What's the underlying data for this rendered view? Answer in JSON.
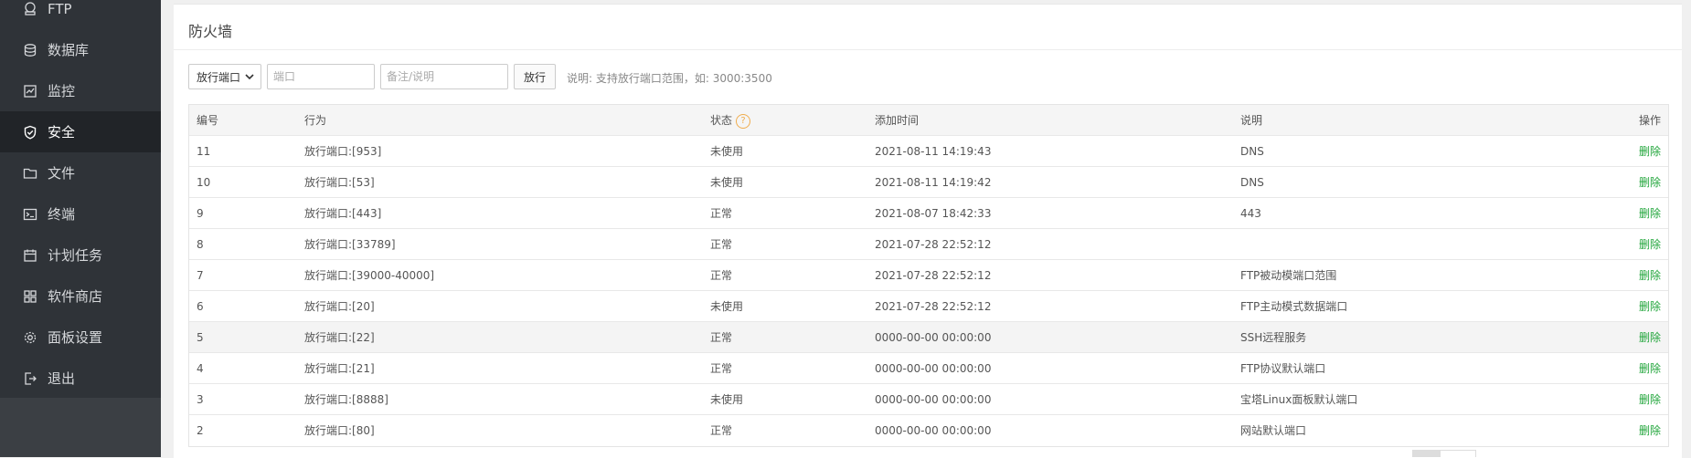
{
  "sidebar": {
    "items": [
      {
        "label": "FTP",
        "icon": "ftp-icon"
      },
      {
        "label": "数据库",
        "icon": "database-icon"
      },
      {
        "label": "监控",
        "icon": "monitor-icon"
      },
      {
        "label": "安全",
        "icon": "shield-icon",
        "active": true
      },
      {
        "label": "文件",
        "icon": "folder-icon"
      },
      {
        "label": "终端",
        "icon": "terminal-icon"
      },
      {
        "label": "计划任务",
        "icon": "calendar-icon"
      },
      {
        "label": "软件商店",
        "icon": "apps-icon"
      },
      {
        "label": "面板设置",
        "icon": "gear-icon"
      },
      {
        "label": "退出",
        "icon": "logout-icon"
      }
    ]
  },
  "panel": {
    "title": "防火墙"
  },
  "toolbar": {
    "select_value": "放行端口",
    "port_placeholder": "端口",
    "note_placeholder": "备注/说明",
    "submit_label": "放行",
    "hint": "说明: 支持放行端口范围，如: 3000:3500"
  },
  "table": {
    "headers": {
      "id": "编号",
      "action": "行为",
      "status": "状态",
      "time": "添加时间",
      "desc": "说明",
      "op": "操作"
    },
    "status_help": "?",
    "rows": [
      {
        "id": "11",
        "action": "放行端口:[953]",
        "status": "未使用",
        "time": "2021-08-11 14:19:43",
        "desc": "DNS",
        "op": "删除"
      },
      {
        "id": "10",
        "action": "放行端口:[53]",
        "status": "未使用",
        "time": "2021-08-11 14:19:42",
        "desc": "DNS",
        "op": "删除"
      },
      {
        "id": "9",
        "action": "放行端口:[443]",
        "status": "正常",
        "time": "2021-08-07 18:42:33",
        "desc": "443",
        "op": "删除"
      },
      {
        "id": "8",
        "action": "放行端口:[33789]",
        "status": "正常",
        "time": "2021-07-28 22:52:12",
        "desc": "",
        "op": "删除"
      },
      {
        "id": "7",
        "action": "放行端口:[39000-40000]",
        "status": "正常",
        "time": "2021-07-28 22:52:12",
        "desc": "FTP被动模端口范围",
        "op": "删除"
      },
      {
        "id": "6",
        "action": "放行端口:[20]",
        "status": "未使用",
        "time": "2021-07-28 22:52:12",
        "desc": "FTP主动模式数据端口",
        "op": "删除"
      },
      {
        "id": "5",
        "action": "放行端口:[22]",
        "status": "正常",
        "time": "0000-00-00 00:00:00",
        "desc": "SSH远程服务",
        "op": "删除"
      },
      {
        "id": "4",
        "action": "放行端口:[21]",
        "status": "正常",
        "time": "0000-00-00 00:00:00",
        "desc": "FTP协议默认端口",
        "op": "删除"
      },
      {
        "id": "3",
        "action": "放行端口:[8888]",
        "status": "未使用",
        "time": "0000-00-00 00:00:00",
        "desc": "宝塔Linux面板默认端口",
        "op": "删除"
      },
      {
        "id": "2",
        "action": "放行端口:[80]",
        "status": "正常",
        "time": "0000-00-00 00:00:00",
        "desc": "网站默认端口",
        "op": "删除"
      }
    ]
  },
  "colors": {
    "sidebar_bg": "#2f3338",
    "sidebar_active": "#212428",
    "delete_link": "#20a53a",
    "help_icon": "#f0ad4e"
  }
}
